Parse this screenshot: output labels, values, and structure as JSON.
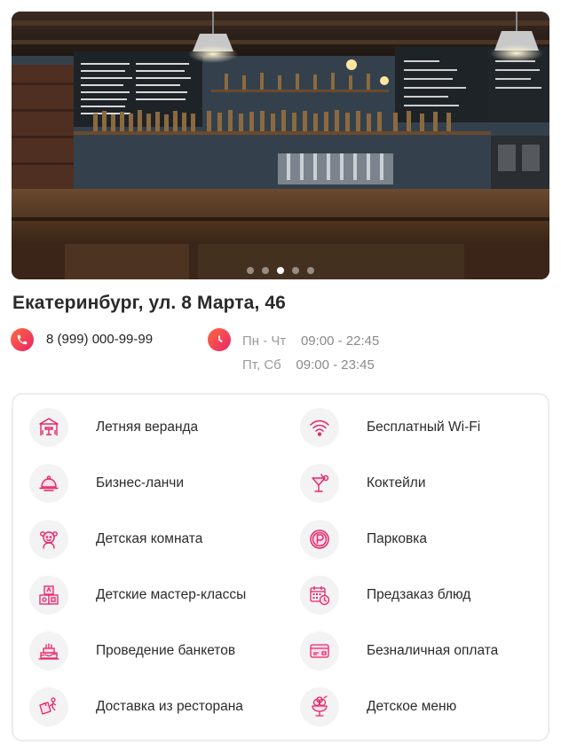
{
  "photo": {
    "alt": "bar interior",
    "slides_total": 5,
    "active_slide": 3
  },
  "address": "Екатеринбург, ул. 8 Марта, 46",
  "phone": {
    "icon": "phone-icon",
    "number": "8 (999) 000-99-99"
  },
  "hours": {
    "icon": "clock-icon",
    "rows": [
      {
        "days": "Пн - Чт",
        "time": "09:00 - 22:45"
      },
      {
        "days": "Пт, Сб",
        "time": "09:00 - 23:45"
      }
    ]
  },
  "features": [
    {
      "label": "Летняя веранда",
      "icon": "veranda-icon"
    },
    {
      "label": "Бесплатный Wi-Fi",
      "icon": "wifi-icon"
    },
    {
      "label": "Бизнес-ланчи",
      "icon": "cloche-icon"
    },
    {
      "label": "Коктейли",
      "icon": "cocktail-icon"
    },
    {
      "label": "Детская комната",
      "icon": "child-icon"
    },
    {
      "label": "Парковка",
      "icon": "parking-icon"
    },
    {
      "label": "Детские мастер-классы",
      "icon": "toy-blocks-icon"
    },
    {
      "label": "Предзаказ блюд",
      "icon": "calendar-clock-icon"
    },
    {
      "label": "Проведение банкетов",
      "icon": "cake-icon"
    },
    {
      "label": "Безналичная оплата",
      "icon": "credit-card-icon"
    },
    {
      "label": "Доставка из ресторана",
      "icon": "delivery-icon"
    },
    {
      "label": "Детское меню",
      "icon": "ice-cream-icon"
    }
  ],
  "colors": {
    "accent_start": "#ff6a3d",
    "accent_end": "#e8246b",
    "icon_pink": "#e8246b"
  }
}
